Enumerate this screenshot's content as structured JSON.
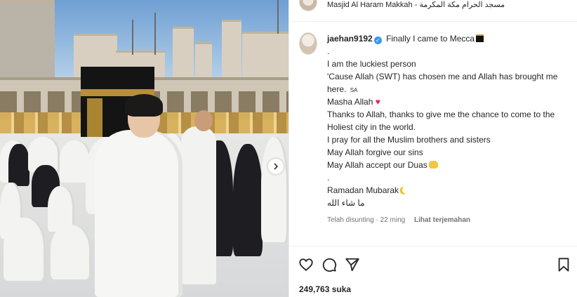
{
  "header": {
    "location": "Masjid Al Haram Makkah - مسجد الحرام مكة المكرمة"
  },
  "post": {
    "username": "jaehan9192",
    "caption_lines": [
      "Finally I came to Mecca",
      ".",
      "I am the luckiest person",
      "'Cause Allah (SWT) has chosen me and Allah has brought me",
      "here.",
      "Masha Allah",
      "Thanks to Allah, thanks to give me the chance to come to the",
      "Holiest city in the world.",
      "I pray for all the Muslim brothers and sisters",
      "May Allah forgive our sins",
      "May Allah accept our Duas",
      ".",
      "Ramadan Mubarak",
      "ما شاء الله"
    ],
    "sa_mark": "SA",
    "edited_label": "Telah disunting",
    "time_ago": "22 ming",
    "meta_separator": "·",
    "see_translation": "Lihat terjemahan",
    "likes": "249,763 suka"
  },
  "icons": {
    "verified": "verified-badge-icon",
    "like": "heart-icon",
    "comment": "comment-icon",
    "share": "send-icon",
    "save": "bookmark-icon",
    "carousel_next": "chevron-right-icon"
  },
  "colors": {
    "verified": "#3897f0",
    "heart_emoji": "#e0245e",
    "meta_text": "#737373",
    "text": "#262626"
  }
}
